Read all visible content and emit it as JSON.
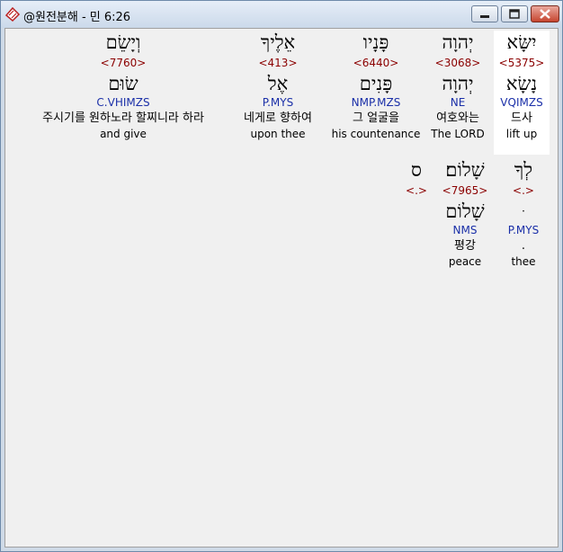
{
  "window": {
    "title": "@원전분해 - 민 6:26"
  },
  "verse": {
    "row1": [
      {
        "heb": "יִשָּׂא",
        "num": "<5375>",
        "heb2": "נָשָׂא",
        "parse": "VQIMZS",
        "ko": "드사",
        "en": "lift up"
      },
      {
        "heb": "יְהוָה",
        "num": "<3068>",
        "heb2": "יְהוָה",
        "parse": "NE",
        "ko": "여호와는",
        "en": "The LORD"
      },
      {
        "heb": "פָּנָיו",
        "num": "<6440>",
        "heb2": "פָּנִים",
        "parse": "NMP.MZS",
        "ko": "그 얼굴을",
        "en": "his countenance"
      },
      {
        "heb": "אֵלֶיךָ",
        "num": "<413>",
        "heb2": "אֶל",
        "parse": "P.MYS",
        "ko": "네게로 향하여",
        "en": "upon thee"
      },
      {
        "heb": "וְיָשֵׂם",
        "num": "<7760>",
        "heb2": "שׂוּם",
        "parse": "C.VHIMZS",
        "ko": "주시기를 원하노라 할찌니라 하라",
        "en": "and give"
      }
    ],
    "row2": [
      {
        "heb": "לְךָ",
        "num": "<.>",
        "heb2": "ּ",
        "parse": "P.MYS",
        "ko": ".",
        "en": "thee"
      },
      {
        "heb": "שָׁלוֹם׃",
        "num": "<7965>",
        "heb2": "שָׁלוֹם",
        "parse": "NMS",
        "ko": "평강",
        "en": "peace"
      },
      {
        "heb": "ס",
        "num": "<.>",
        "heb2": "",
        "parse": "",
        "ko": "",
        "en": ""
      }
    ]
  }
}
